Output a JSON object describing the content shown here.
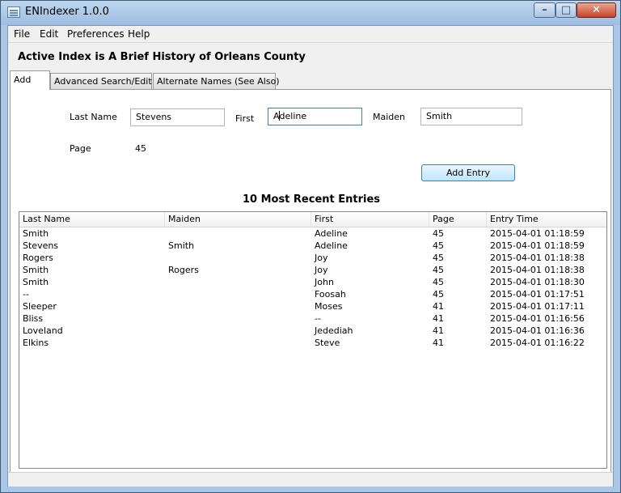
{
  "window": {
    "title": "ENIndexer 1.0.0",
    "min": "–",
    "max": "□",
    "close": "✕"
  },
  "menu": [
    "File",
    "Edit",
    "Preferences",
    "Help"
  ],
  "heading": "Active Index is A Brief History of Orleans County",
  "tabs": [
    "Add",
    "Advanced Search/Edit",
    "Alternate Names (See Also)"
  ],
  "form": {
    "last_label": "Last Name",
    "last_value": "Stevens",
    "first_label": "First",
    "first_value_a": "A",
    "first_value_b": "deline",
    "maiden_label": "Maiden",
    "maiden_value": "Smith",
    "page_label": "Page",
    "page_value": "45",
    "add_button": "Add Entry"
  },
  "recent": {
    "title": "10 Most Recent Entries",
    "columns": [
      "Last Name",
      "Maiden",
      "First",
      "Page",
      "Entry Time"
    ],
    "rows": [
      [
        "Smith",
        "",
        "Adeline",
        "45",
        "2015-04-01 01:18:59"
      ],
      [
        "Stevens",
        "Smith",
        "Adeline",
        "45",
        "2015-04-01 01:18:59"
      ],
      [
        "Rogers",
        "",
        "Joy",
        "45",
        "2015-04-01 01:18:38"
      ],
      [
        "Smith",
        "Rogers",
        "Joy",
        "45",
        "2015-04-01 01:18:38"
      ],
      [
        "Smith",
        "",
        "John",
        "45",
        "2015-04-01 01:18:30"
      ],
      [
        "--",
        "",
        "Foosah",
        "45",
        "2015-04-01 01:17:51"
      ],
      [
        "Sleeper",
        "",
        "Moses",
        "41",
        "2015-04-01 01:17:11"
      ],
      [
        "Bliss",
        "",
        "--",
        "41",
        "2015-04-01 01:16:56"
      ],
      [
        "Loveland",
        "",
        "Jedediah",
        "41",
        "2015-04-01 01:16:36"
      ],
      [
        "Elkins",
        "",
        "Steve",
        "41",
        "2015-04-01 01:16:22"
      ]
    ]
  }
}
